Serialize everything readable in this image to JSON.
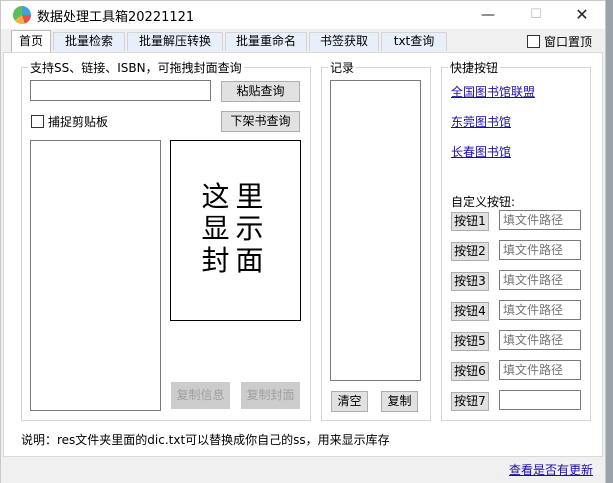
{
  "window": {
    "title": "数据处理工具箱20221121",
    "min_glyph": "—",
    "max_glyph": "☐",
    "close_glyph": "✕"
  },
  "tabs": [
    {
      "label": "首页",
      "active": true
    },
    {
      "label": "批量检索",
      "active": false
    },
    {
      "label": "批量解压转换",
      "active": false
    },
    {
      "label": "批量重命名",
      "active": false
    },
    {
      "label": "书签获取",
      "active": false
    },
    {
      "label": "txt查询",
      "active": false
    }
  ],
  "always_on_top": {
    "label": "窗口置顶",
    "checked": false
  },
  "search_group": {
    "title": "支持SS、链接、ISBN，可拖拽封面查询",
    "input_value": "",
    "paste_query": "粘贴查询",
    "capture_clipboard": "捕捉剪贴板",
    "offshelf_query": "下架书查询",
    "cover_placeholder": "这里\n显示\n封面",
    "copy_info": "复制信息",
    "copy_cover": "复制封面"
  },
  "record_group": {
    "title": "记录",
    "clear": "清空",
    "copy": "复制"
  },
  "quick_group": {
    "title": "快捷按钮",
    "links": [
      "全国图书馆联盟",
      "东莞图书馆",
      "长春图书馆"
    ],
    "custom_label": "自定义按钮:",
    "custom_buttons": [
      {
        "label": "按钮1",
        "placeholder": "填文件路径"
      },
      {
        "label": "按钮2",
        "placeholder": "填文件路径"
      },
      {
        "label": "按钮3",
        "placeholder": "填文件路径"
      },
      {
        "label": "按钮4",
        "placeholder": "填文件路径"
      },
      {
        "label": "按钮5",
        "placeholder": "填文件路径"
      },
      {
        "label": "按钮6",
        "placeholder": "填文件路径"
      },
      {
        "label": "按钮7",
        "placeholder": ""
      }
    ]
  },
  "notice": "说明：res文件夹里面的dic.txt可以替换成你自己的ss，用来显示库存",
  "check_update": "查看是否有更新"
}
